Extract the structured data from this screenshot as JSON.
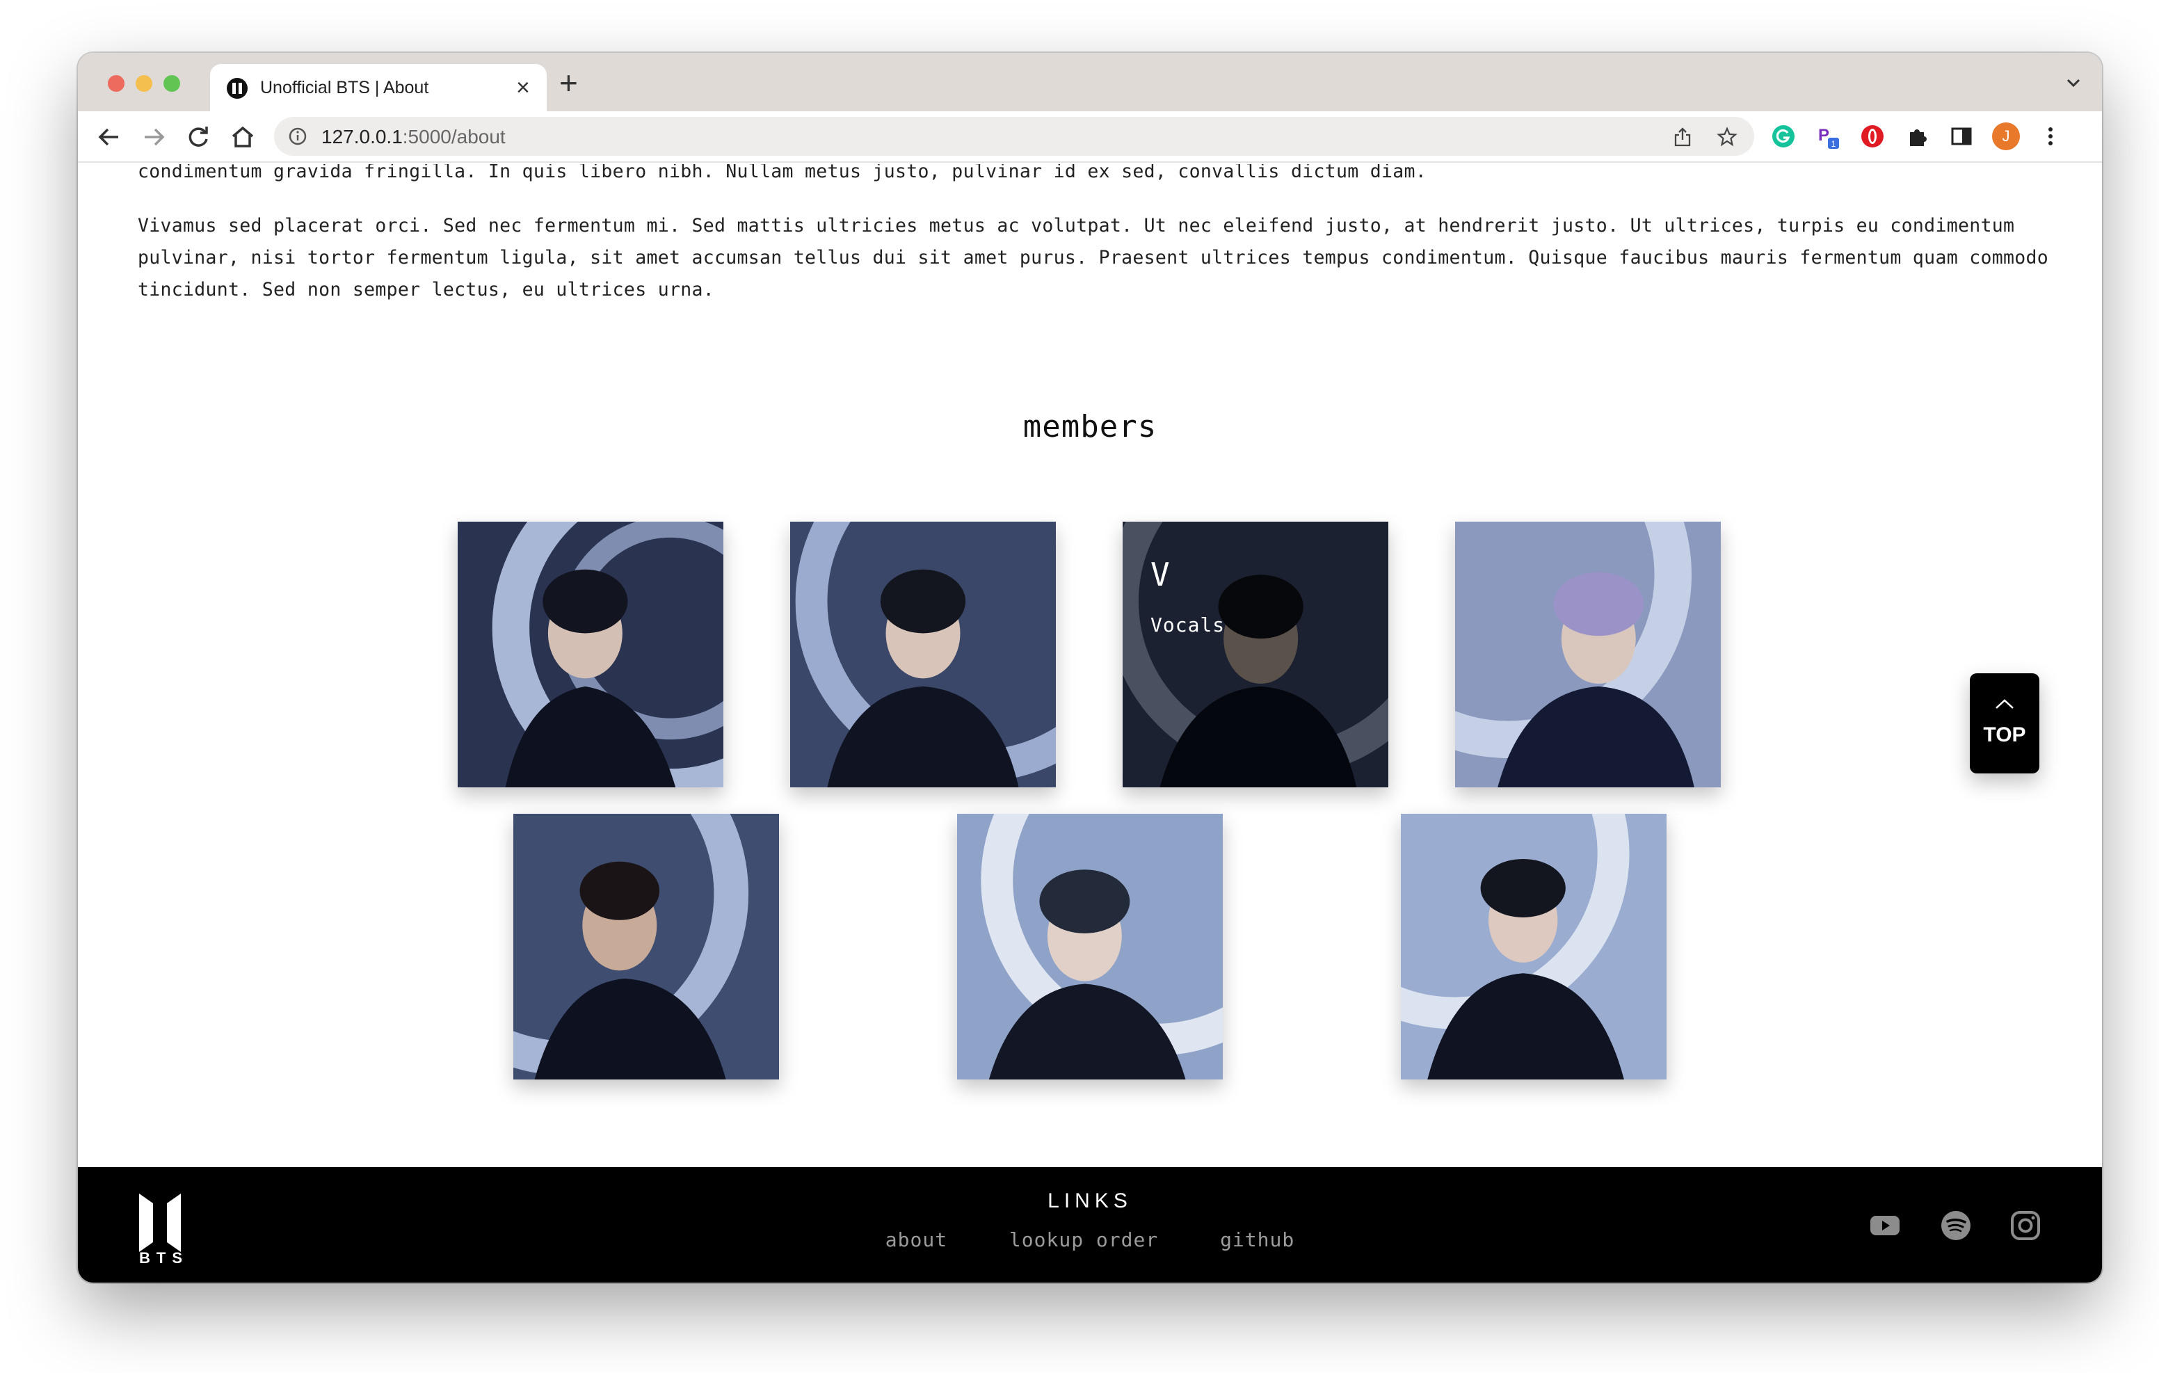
{
  "browser": {
    "tab_title": "Unofficial BTS | About",
    "url_host": "127.0.0.1",
    "url_path": ":5000/about",
    "profile_initial": "J",
    "extension_badge": "1"
  },
  "content": {
    "paragraph_partial": "condimentum gravida fringilla. In quis libero nibh. Nullam metus justo, pulvinar id ex sed, convallis dictum diam.",
    "paragraph": "Vivamus sed placerat orci. Sed nec fermentum mi. Sed mattis ultricies metus ac volutpat. Ut nec eleifend justo, at hendrerit justo. Ut ultrices, turpis eu condimentum pulvinar, nisi tortor fermentum ligula, sit amet accumsan tellus dui sit amet purus. Praesent ultrices tempus condimentum. Quisque faucibus mauris fermentum quam commodo tincidunt. Sed non semper lectus, eu ultrices urna.",
    "members_heading": "members",
    "hovered_member": {
      "name": "V",
      "role": "Vocals"
    },
    "top_button": "TOP"
  },
  "footer": {
    "logo_text": "BTS",
    "links_heading": "LINKS",
    "links": [
      "about",
      "lookup order",
      "github"
    ]
  },
  "colors": {
    "footer_bg": "#000000",
    "photo_tone_light": "#b8c6e0",
    "photo_tone_dark": "#141b33"
  }
}
